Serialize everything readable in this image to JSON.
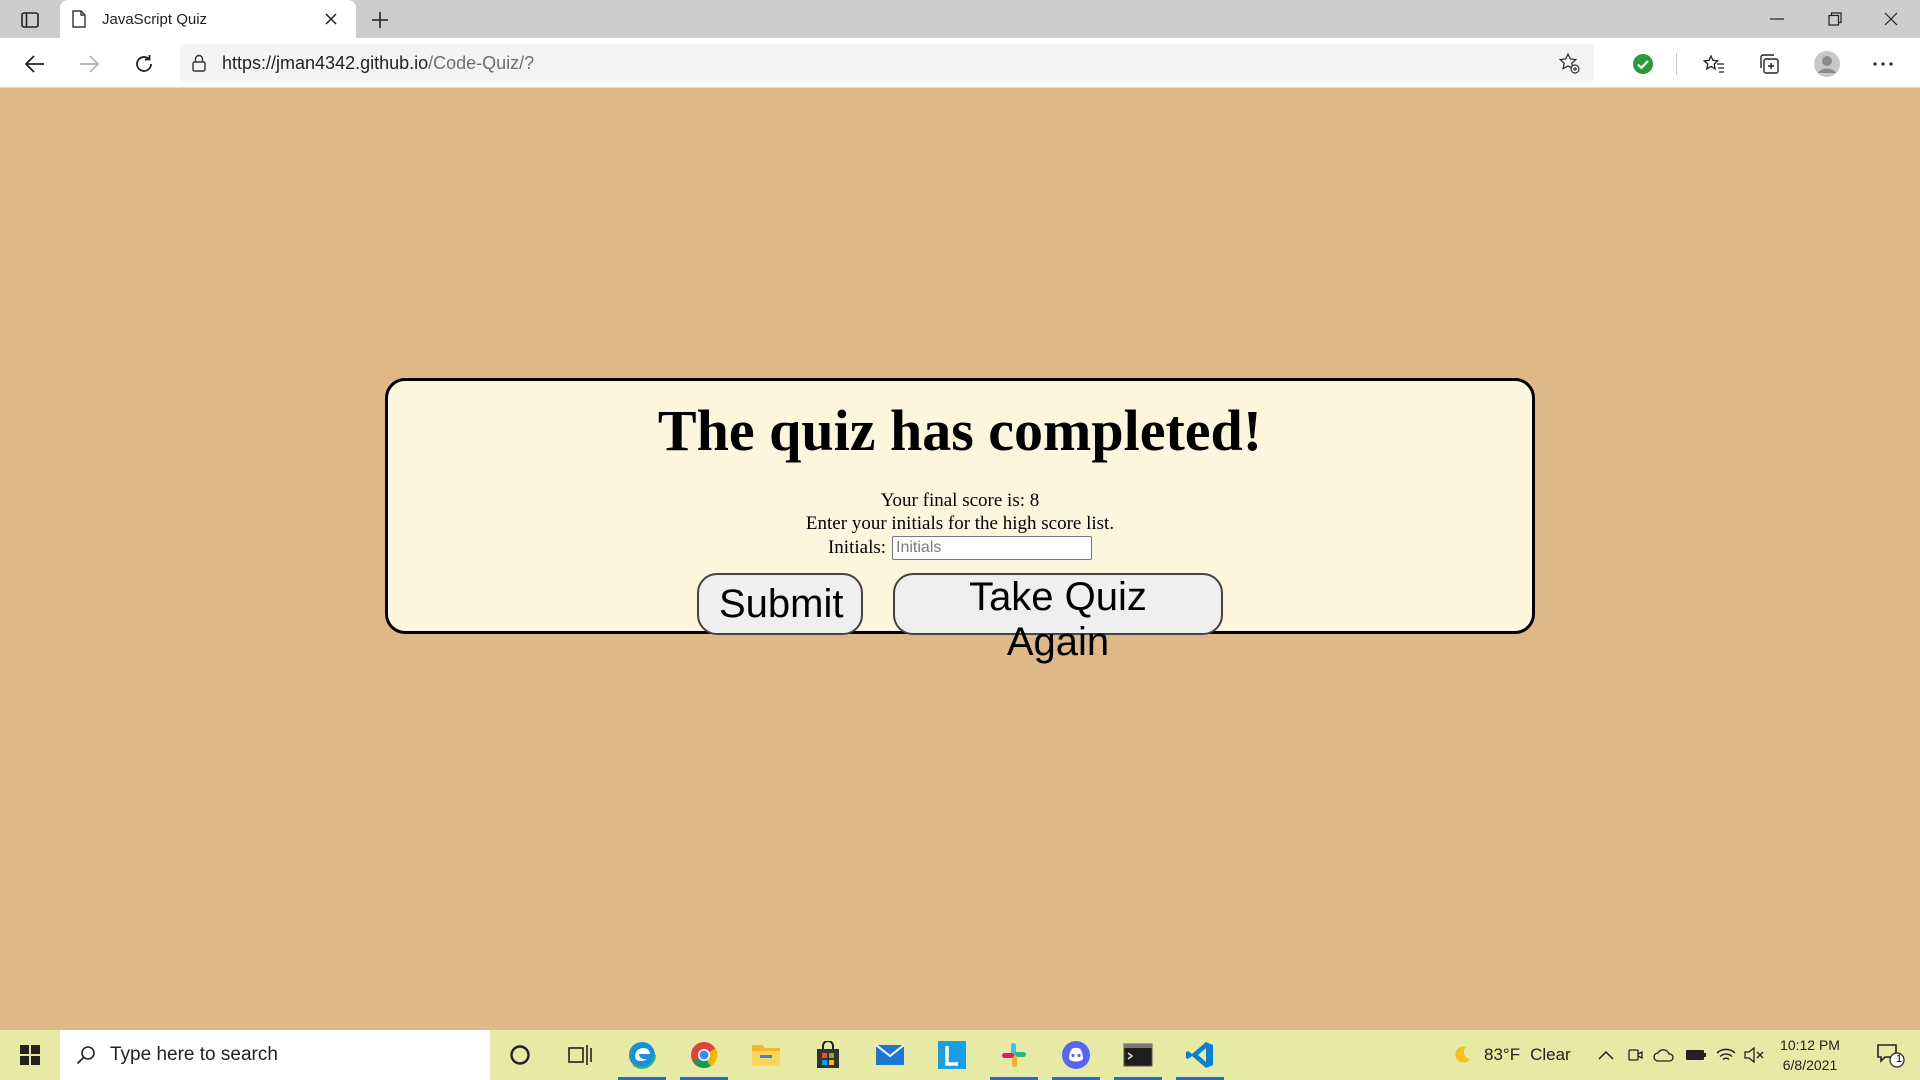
{
  "browser": {
    "tab_title": "JavaScript Quiz",
    "url_host": "https://jman4342.github.io",
    "url_path": "/Code-Quiz/?",
    "icons": [
      "tab-actions-icon",
      "page-icon",
      "close-icon",
      "plus-icon",
      "minimize-icon",
      "restore-icon",
      "close-icon",
      "back-icon",
      "forward-icon",
      "refresh-icon",
      "lock-icon",
      "add-favorite-icon",
      "extension-check-icon",
      "favorites-icon",
      "collections-icon",
      "profile-icon",
      "more-icon"
    ]
  },
  "quiz": {
    "heading": "The quiz has completed!",
    "score_text": "Your final score is: 8",
    "prompt_text": "Enter your initials for the high score list.",
    "initials_label": "Initials:",
    "initials_value": "",
    "initials_placeholder": "Initials",
    "submit_label": "Submit",
    "again_label": "Take Quiz Again"
  },
  "taskbar": {
    "search_placeholder": "Type here to search",
    "weather_temp": "83°F",
    "weather_cond": "Clear",
    "time": "10:12 PM",
    "date": "6/8/2021",
    "notification_count": "1"
  },
  "colors": {
    "page_bg": "#deb887",
    "card_bg": "#fdf5dc",
    "taskbar_bg": "#e6eaa4",
    "accent": "#1f6fd0"
  }
}
